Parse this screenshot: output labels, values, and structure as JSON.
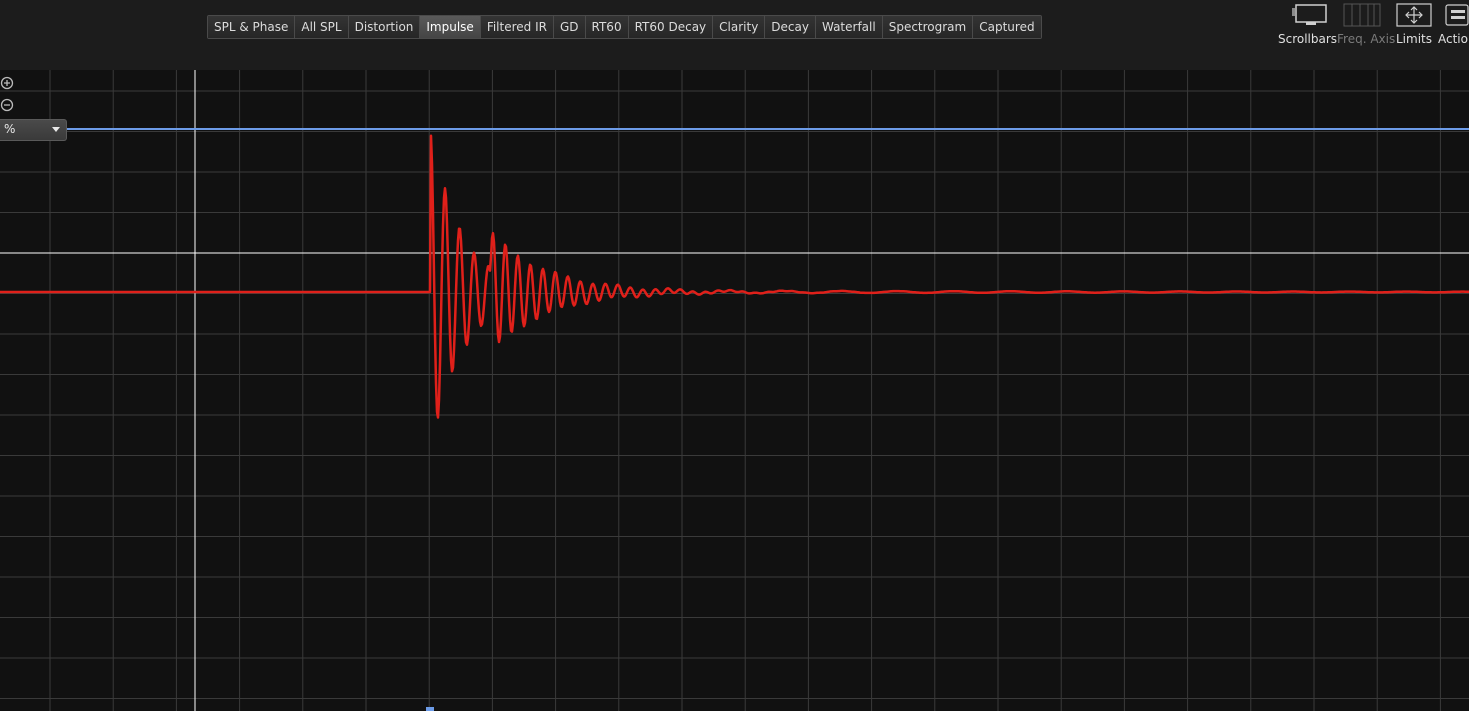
{
  "tabs": [
    {
      "label": "SPL & Phase",
      "active": false
    },
    {
      "label": "All SPL",
      "active": false
    },
    {
      "label": "Distortion",
      "active": false
    },
    {
      "label": "Impulse",
      "active": true
    },
    {
      "label": "Filtered IR",
      "active": false
    },
    {
      "label": "GD",
      "active": false
    },
    {
      "label": "RT60",
      "active": false
    },
    {
      "label": "RT60 Decay",
      "active": false
    },
    {
      "label": "Clarity",
      "active": false
    },
    {
      "label": "Decay",
      "active": false
    },
    {
      "label": "Waterfall",
      "active": false
    },
    {
      "label": "Spectrogram",
      "active": false
    },
    {
      "label": "Captured",
      "active": false
    }
  ],
  "tools": {
    "scrollbars": "Scrollbars",
    "freq_axis": "Freq. Axis",
    "limits": "Limits",
    "actions": "Actions"
  },
  "plot": {
    "unit_selected": "%",
    "zoom_in_icon": "zoom-in-icon",
    "zoom_out_icon": "zoom-out-icon"
  },
  "colors": {
    "background": "#111111",
    "grid": "#3a3a3a",
    "impulse_trace": "#e0201a",
    "peak_line": "#6d9ce8",
    "cursor": "#ffffff"
  },
  "chart_data": {
    "type": "line",
    "grid": true,
    "series": [
      {
        "color": "#e0201a",
        "description": "impulse response, damped oscillation after the peak"
      }
    ]
  }
}
